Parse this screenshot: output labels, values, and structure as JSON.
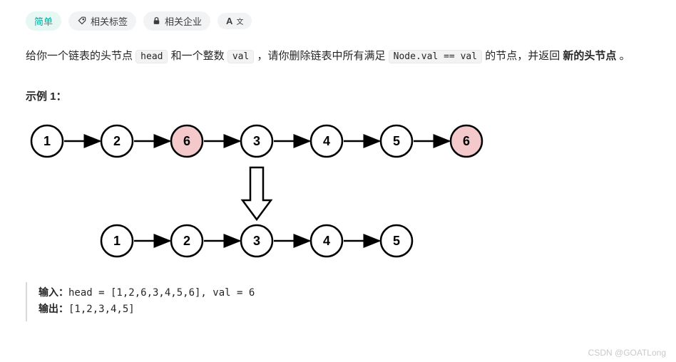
{
  "tags": {
    "difficulty": "简单",
    "related_tags": "相关标签",
    "related_companies": "相关企业",
    "translate": "A"
  },
  "description": {
    "part1": "给你一个链表的头节点 ",
    "code1": "head",
    "part2": " 和一个整数 ",
    "code2": "val",
    "part3": " ，请你删除链表中所有满足 ",
    "code3": "Node.val == val",
    "part4": " 的节点，并返回 ",
    "bold1": "新的头节点",
    "part5": " 。"
  },
  "example_label": "示例 1：",
  "diagram": {
    "list_before": [
      {
        "v": "1",
        "hl": false
      },
      {
        "v": "2",
        "hl": false
      },
      {
        "v": "6",
        "hl": true
      },
      {
        "v": "3",
        "hl": false
      },
      {
        "v": "4",
        "hl": false
      },
      {
        "v": "5",
        "hl": false
      },
      {
        "v": "6",
        "hl": true
      }
    ],
    "list_after": [
      {
        "v": "1"
      },
      {
        "v": "2"
      },
      {
        "v": "3"
      },
      {
        "v": "4"
      },
      {
        "v": "5"
      }
    ]
  },
  "io": {
    "input_label": "输入：",
    "input_value": "head = [1,2,6,3,4,5,6], val = 6",
    "output_label": "输出：",
    "output_value": "[1,2,3,4,5]"
  },
  "watermark": "CSDN @GOATLong"
}
